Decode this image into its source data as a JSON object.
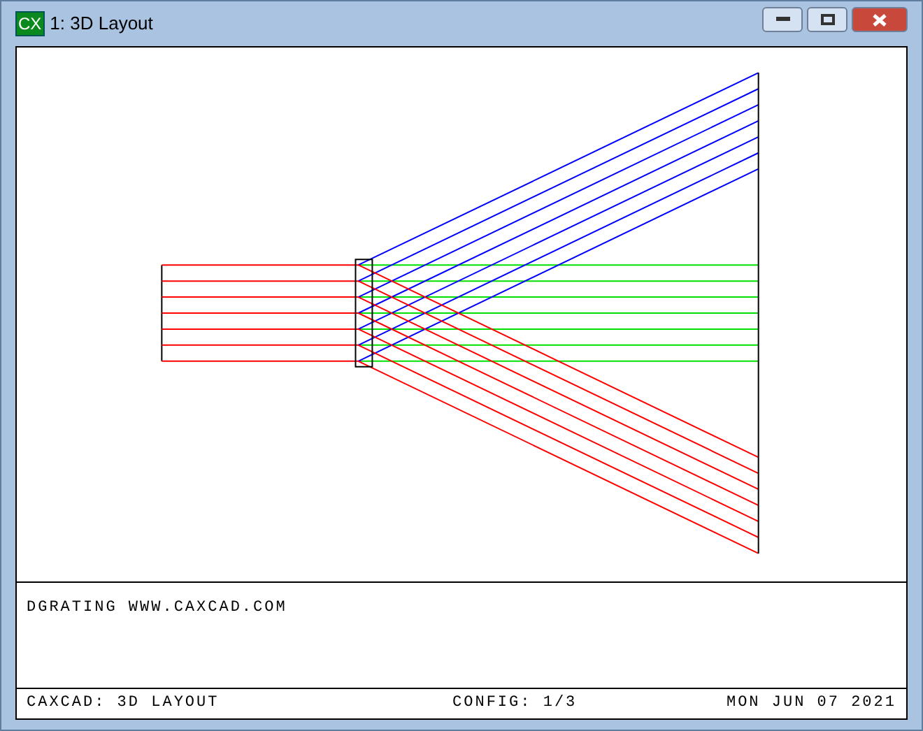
{
  "window": {
    "title": "1: 3D Layout",
    "icon_text": "CX"
  },
  "message": "DGRATING WWW.CAXCAD.COM",
  "status_bar": {
    "left": "CAXCAD: 3D LAYOUT",
    "center": "CONFIG: 1/3",
    "right": "MON JUN 07 2021"
  }
}
